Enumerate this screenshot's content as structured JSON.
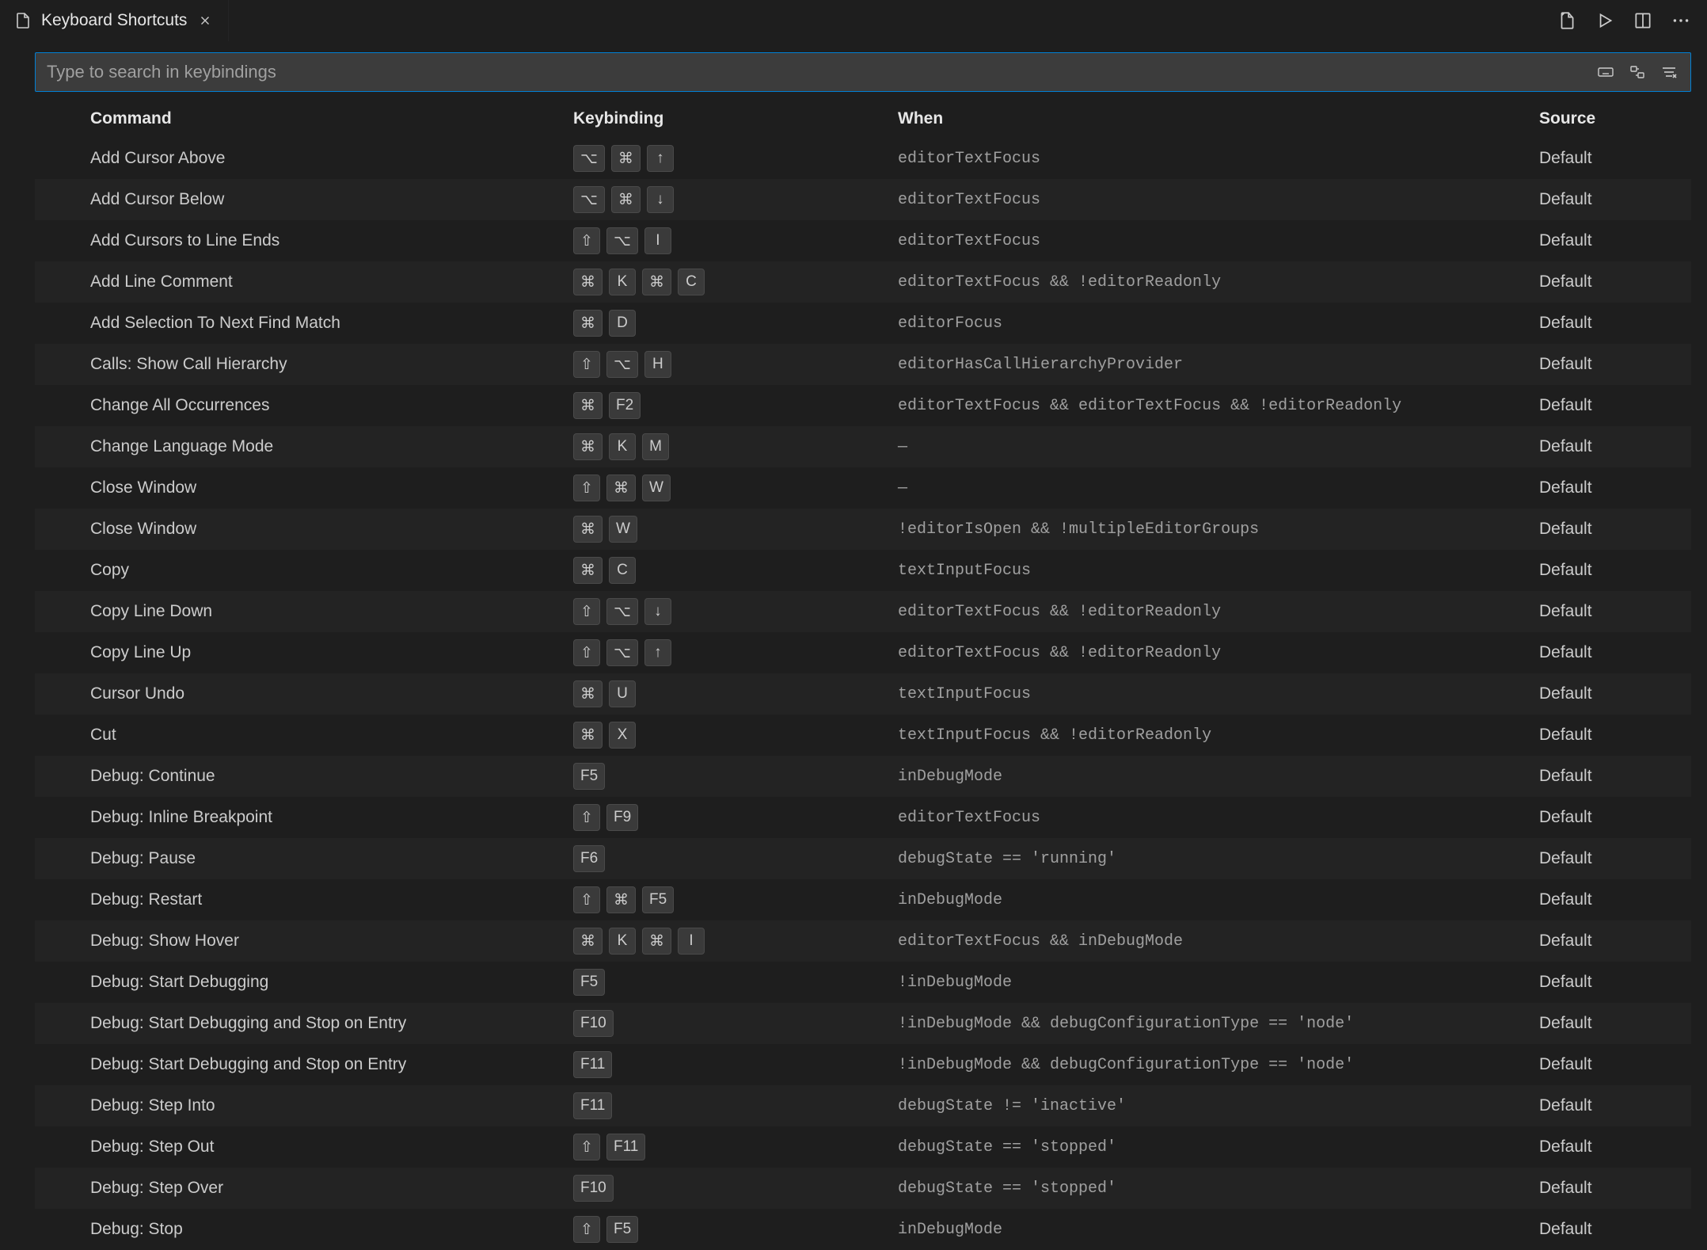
{
  "tab": {
    "title": "Keyboard Shortcuts"
  },
  "search": {
    "placeholder": "Type to search in keybindings",
    "value": ""
  },
  "headers": {
    "command": "Command",
    "keybinding": "Keybinding",
    "when": "When",
    "source": "Source"
  },
  "rows": [
    {
      "command": "Add Cursor Above",
      "keys": [
        "⌥",
        "⌘",
        "↑"
      ],
      "when": "editorTextFocus",
      "source": "Default"
    },
    {
      "command": "Add Cursor Below",
      "keys": [
        "⌥",
        "⌘",
        "↓"
      ],
      "when": "editorTextFocus",
      "source": "Default"
    },
    {
      "command": "Add Cursors to Line Ends",
      "keys": [
        "⇧",
        "⌥",
        "I"
      ],
      "when": "editorTextFocus",
      "source": "Default"
    },
    {
      "command": "Add Line Comment",
      "keys": [
        "⌘",
        "K",
        "⌘",
        "C"
      ],
      "when": "editorTextFocus && !editorReadonly",
      "source": "Default"
    },
    {
      "command": "Add Selection To Next Find Match",
      "keys": [
        "⌘",
        "D"
      ],
      "when": "editorFocus",
      "source": "Default"
    },
    {
      "command": "Calls: Show Call Hierarchy",
      "keys": [
        "⇧",
        "⌥",
        "H"
      ],
      "when": "editorHasCallHierarchyProvider",
      "source": "Default"
    },
    {
      "command": "Change All Occurrences",
      "keys": [
        "⌘",
        "F2"
      ],
      "when": "editorTextFocus && editorTextFocus && !editorReadonly",
      "source": "Default"
    },
    {
      "command": "Change Language Mode",
      "keys": [
        "⌘",
        "K",
        "M"
      ],
      "when": "—",
      "source": "Default"
    },
    {
      "command": "Close Window",
      "keys": [
        "⇧",
        "⌘",
        "W"
      ],
      "when": "—",
      "source": "Default"
    },
    {
      "command": "Close Window",
      "keys": [
        "⌘",
        "W"
      ],
      "when": "!editorIsOpen && !multipleEditorGroups",
      "source": "Default"
    },
    {
      "command": "Copy",
      "keys": [
        "⌘",
        "C"
      ],
      "when": "textInputFocus",
      "source": "Default"
    },
    {
      "command": "Copy Line Down",
      "keys": [
        "⇧",
        "⌥",
        "↓"
      ],
      "when": "editorTextFocus && !editorReadonly",
      "source": "Default"
    },
    {
      "command": "Copy Line Up",
      "keys": [
        "⇧",
        "⌥",
        "↑"
      ],
      "when": "editorTextFocus && !editorReadonly",
      "source": "Default"
    },
    {
      "command": "Cursor Undo",
      "keys": [
        "⌘",
        "U"
      ],
      "when": "textInputFocus",
      "source": "Default"
    },
    {
      "command": "Cut",
      "keys": [
        "⌘",
        "X"
      ],
      "when": "textInputFocus && !editorReadonly",
      "source": "Default"
    },
    {
      "command": "Debug: Continue",
      "keys": [
        "F5"
      ],
      "when": "inDebugMode",
      "source": "Default"
    },
    {
      "command": "Debug: Inline Breakpoint",
      "keys": [
        "⇧",
        "F9"
      ],
      "when": "editorTextFocus",
      "source": "Default"
    },
    {
      "command": "Debug: Pause",
      "keys": [
        "F6"
      ],
      "when": "debugState == 'running'",
      "source": "Default"
    },
    {
      "command": "Debug: Restart",
      "keys": [
        "⇧",
        "⌘",
        "F5"
      ],
      "when": "inDebugMode",
      "source": "Default"
    },
    {
      "command": "Debug: Show Hover",
      "keys": [
        "⌘",
        "K",
        "⌘",
        "I"
      ],
      "when": "editorTextFocus && inDebugMode",
      "source": "Default"
    },
    {
      "command": "Debug: Start Debugging",
      "keys": [
        "F5"
      ],
      "when": "!inDebugMode",
      "source": "Default"
    },
    {
      "command": "Debug: Start Debugging and Stop on Entry",
      "keys": [
        "F10"
      ],
      "when": "!inDebugMode && debugConfigurationType == 'node'",
      "source": "Default"
    },
    {
      "command": "Debug: Start Debugging and Stop on Entry",
      "keys": [
        "F11"
      ],
      "when": "!inDebugMode && debugConfigurationType == 'node'",
      "source": "Default"
    },
    {
      "command": "Debug: Step Into",
      "keys": [
        "F11"
      ],
      "when": "debugState != 'inactive'",
      "source": "Default"
    },
    {
      "command": "Debug: Step Out",
      "keys": [
        "⇧",
        "F11"
      ],
      "when": "debugState == 'stopped'",
      "source": "Default"
    },
    {
      "command": "Debug: Step Over",
      "keys": [
        "F10"
      ],
      "when": "debugState == 'stopped'",
      "source": "Default"
    },
    {
      "command": "Debug: Stop",
      "keys": [
        "⇧",
        "F5"
      ],
      "when": "inDebugMode",
      "source": "Default"
    }
  ]
}
